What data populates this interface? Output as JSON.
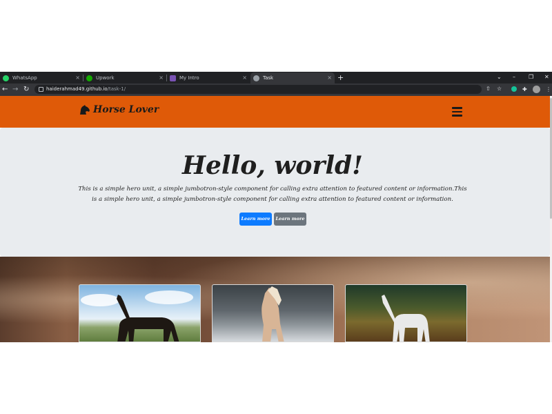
{
  "browser": {
    "tabs": [
      {
        "label": "WhatsApp",
        "active": false
      },
      {
        "label": "Upwork",
        "active": false
      },
      {
        "label": "My Intro",
        "active": false
      },
      {
        "label": "Task",
        "active": true
      }
    ],
    "tab_close_glyph": "×",
    "new_tab_glyph": "+",
    "window_controls": {
      "dropdown": "⌄",
      "minimize": "–",
      "restore": "❐",
      "close": "✕"
    },
    "nav": {
      "back": "←",
      "forward": "→",
      "reload": "↻"
    },
    "url": {
      "host": "haiderahmad49.github.io",
      "path": "/task-1/"
    },
    "toolbar_icons": {
      "share": "⇧",
      "bookmark": "☆",
      "extensions": "✚",
      "menu": "⋮"
    }
  },
  "page": {
    "brand": "Horse Lover",
    "hero": {
      "title": "Hello, world!",
      "text": "This is a simple hero unit, a simple jumbotron-style component for calling extra attention to featured content or information.This is a simple hero unit, a simple jumbotron-style component for calling extra attention to featured content or information.",
      "primary_button": "Learn more",
      "secondary_button": "Learn more"
    },
    "colors": {
      "navbar": "#df5a08",
      "hero_bg": "#e9ecef",
      "primary_button": "#0d7bff",
      "secondary_button": "#6c757d"
    },
    "cards": [
      {
        "subject": "dark brown horse under blue sky"
      },
      {
        "subject": "palomino horse in snowy forest"
      },
      {
        "subject": "white horse in autumn forest"
      }
    ]
  }
}
